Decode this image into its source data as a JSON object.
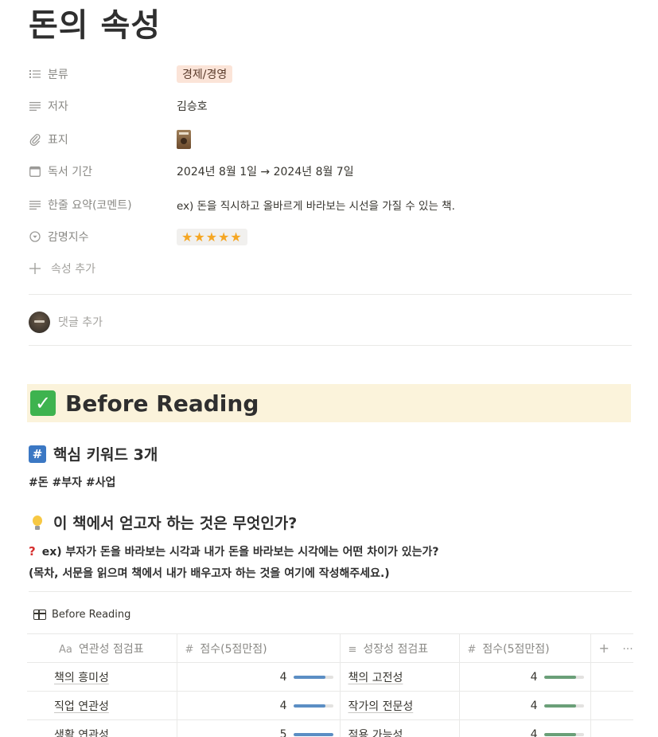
{
  "page": {
    "title": "돈의 속성"
  },
  "properties": [
    {
      "name": "분류",
      "icon": "list-icon",
      "value": "경제/경영",
      "type": "tag"
    },
    {
      "name": "저자",
      "icon": "text-icon",
      "value": "김승호",
      "type": "text"
    },
    {
      "name": "표지",
      "icon": "paperclip-icon",
      "value": "",
      "type": "image"
    },
    {
      "name": "독서 기간",
      "icon": "calendar-icon",
      "value": "2024년 8월 1일 → 2024년 8월 7일",
      "type": "text"
    },
    {
      "name": "한줄 요약(코멘트)",
      "icon": "text-icon",
      "value": "ex) 돈을 직시하고 올바르게 바라보는 시선을 가질 수 있는 책.",
      "type": "text"
    },
    {
      "name": "감명지수",
      "icon": "select-icon",
      "value": "★★★★★",
      "type": "stars"
    }
  ],
  "add_property_label": "속성 추가",
  "comment_placeholder": "댓글 추가",
  "callout": {
    "title": "Before Reading",
    "icon": "check-mark-button-icon",
    "color": "#fbf3db"
  },
  "sections": {
    "keywords": {
      "heading": "핵심 키워드 3개",
      "text": "#돈 #부자 #사업"
    },
    "goal": {
      "heading": "이 책에서 얻고자 하는 것은 무엇인가?",
      "line1": "ex) 부자가 돈을 바라보는 시각과 내가 돈을 바라보는 시각에는 어떤 차이가 있는가?",
      "line2": "(목차, 서문을 읽으며 책에서 내가 배우고자 하는 것을 여기에 작성해주세요.)"
    }
  },
  "database": {
    "title": "Before Reading",
    "columns": [
      {
        "icon": "Aa",
        "label": "연관성 점검표"
      },
      {
        "icon": "#",
        "label": "점수(5점만점)"
      },
      {
        "icon": "≡",
        "label": "성장성 점검표"
      },
      {
        "icon": "#",
        "label": "점수(5점만점)"
      }
    ],
    "add_column": "+",
    "more": "···",
    "rows": [
      {
        "item1": "책의 흥미성",
        "score1": "4",
        "fill1": 0.8,
        "item2": "책의 고전성",
        "score2": "4",
        "fill2": 0.8
      },
      {
        "item1": "직업 연관성",
        "score1": "4",
        "fill1": 0.8,
        "item2": "작가의 전문성",
        "score2": "4",
        "fill2": 0.8
      },
      {
        "item1": "생활 연관성",
        "score1": "5",
        "fill1": 1.0,
        "item2": "적용 가능성",
        "score2": "4",
        "fill2": 0.8
      }
    ],
    "colors": {
      "bar_blue": "#5b8ec4",
      "bar_green": "#6a9f78"
    }
  }
}
